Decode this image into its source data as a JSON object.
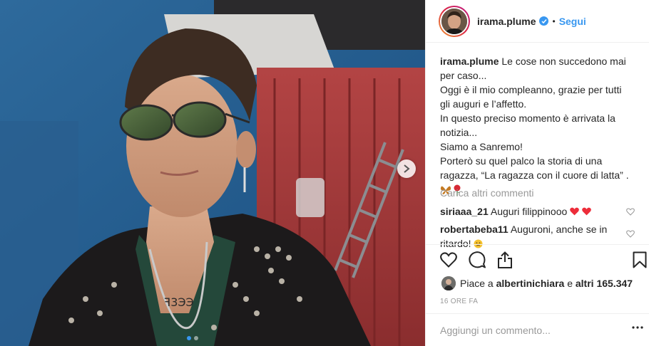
{
  "post": {
    "username": "irama.plume",
    "separator": "•",
    "follow_label": "Segui",
    "caption_lines": [
      "Le cose non succedono mai per caso...",
      "Oggi è il mio compleanno, grazie per tutti gli auguri e l’affetto.",
      "In questo preciso momento è arrivata la notizia...",
      "Siamo a Sanremo!",
      "Porterò su quel palco la storia di una ragazza, “La ragazza con il cuore di latta” ."
    ],
    "load_more": "Carica altri commenti",
    "comments": [
      {
        "user": "siriaaa_21",
        "text": "Auguri filippinooo"
      },
      {
        "user": "robertabeba11",
        "text": "Auguroni, anche se in ritardo!"
      }
    ],
    "likes_prefix": "Piace a",
    "likes_user": "albertinichiara",
    "likes_and": "e",
    "likes_count": "altri 165.347",
    "timestamp": "16 ORE FA",
    "add_comment_placeholder": "Aggiungi un commento..."
  },
  "icons": {
    "verified": "verified-badge-icon",
    "heart": "heart-icon",
    "comment": "comment-icon",
    "share": "share-icon",
    "bookmark": "bookmark-icon",
    "more": "more-options-icon",
    "next": "chevron-right-icon"
  },
  "colors": {
    "accent": "#3897f0",
    "muted": "#999999",
    "heart_red": "#ed4956"
  }
}
